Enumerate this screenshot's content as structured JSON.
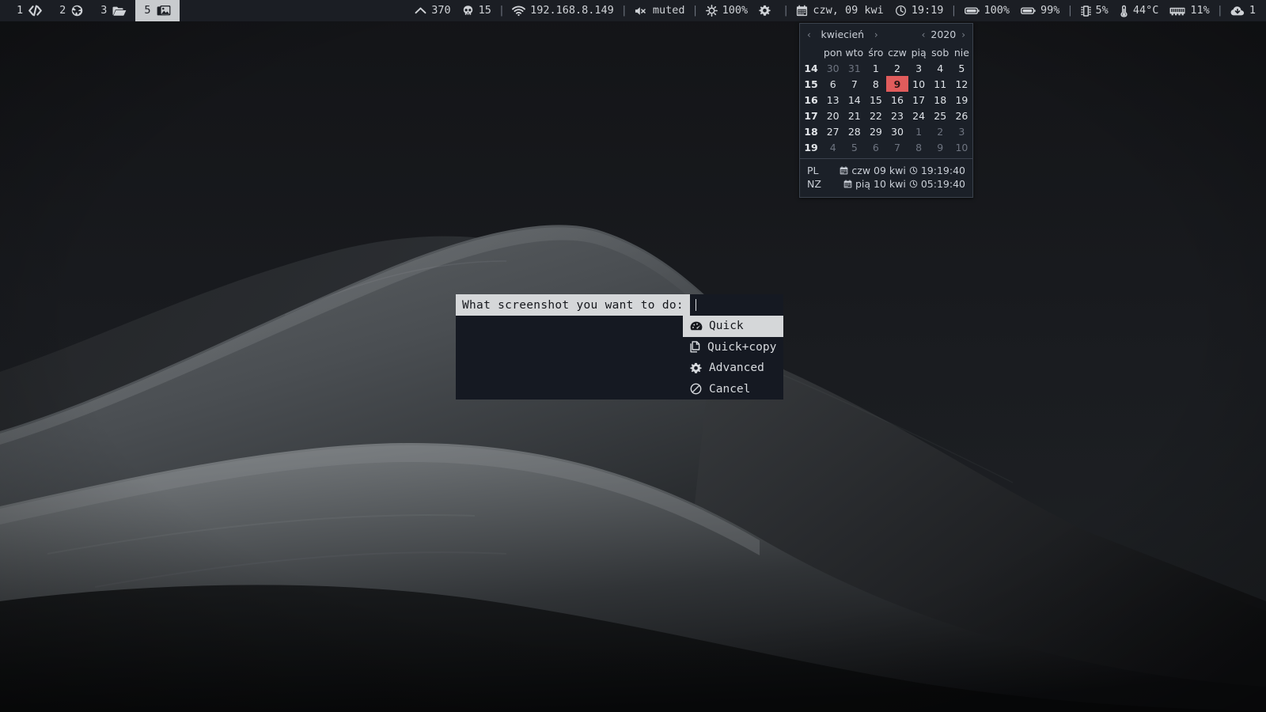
{
  "statusbar": {
    "workspaces": [
      {
        "num": "1",
        "icon": "code-icon",
        "active": false
      },
      {
        "num": "2",
        "icon": "globe-icon",
        "active": false
      },
      {
        "num": "3",
        "icon": "folder-open-icon",
        "active": false
      },
      {
        "num": "5",
        "icon": "image-icon",
        "active": true
      }
    ],
    "segments": [
      {
        "icon": "chevron-up-icon",
        "text": "370"
      },
      {
        "icon": "skull-icon",
        "text": "15"
      },
      {
        "icon": "separator",
        "text": "|"
      },
      {
        "icon": "wifi-icon",
        "text": "192.168.8.149"
      },
      {
        "icon": "separator",
        "text": "|"
      },
      {
        "icon": "volume-muted-icon",
        "text": "muted"
      },
      {
        "icon": "separator",
        "text": "|"
      },
      {
        "icon": "brightness-icon",
        "text": "100%"
      },
      {
        "icon": "gear-icon",
        "text": ""
      },
      {
        "icon": "separator",
        "text": "|"
      },
      {
        "icon": "calendar-icon",
        "text": "czw, 09 kwi"
      },
      {
        "icon": "clock-icon",
        "text": "19:19"
      },
      {
        "icon": "separator",
        "text": "|"
      },
      {
        "icon": "battery-icon",
        "text": "100%"
      },
      {
        "icon": "battery-icon",
        "text": "99%"
      },
      {
        "icon": "separator",
        "text": "|"
      },
      {
        "icon": "cpu-icon",
        "text": "5%"
      },
      {
        "icon": "thermometer-icon",
        "text": "44°C"
      },
      {
        "icon": "memory-icon",
        "text": "11%"
      },
      {
        "icon": "separator",
        "text": "|"
      },
      {
        "icon": "cloud-download-icon",
        "text": "1"
      }
    ]
  },
  "calendar": {
    "month": "kwiecień",
    "year": "2020",
    "prev_month_arrow": "‹",
    "next_month_arrow": "›",
    "prev_year_arrow": "‹",
    "next_year_arrow": "›",
    "weekday_headers": [
      "",
      "pon",
      "wto",
      "śro",
      "czw",
      "pią",
      "sob",
      "nie"
    ],
    "weeks": [
      {
        "wk": "14",
        "days": [
          {
            "d": "30",
            "dim": true
          },
          {
            "d": "31",
            "dim": true
          },
          {
            "d": "1"
          },
          {
            "d": "2"
          },
          {
            "d": "3"
          },
          {
            "d": "4"
          },
          {
            "d": "5"
          }
        ]
      },
      {
        "wk": "15",
        "days": [
          {
            "d": "6"
          },
          {
            "d": "7"
          },
          {
            "d": "8"
          },
          {
            "d": "9",
            "today": true
          },
          {
            "d": "10"
          },
          {
            "d": "11"
          },
          {
            "d": "12"
          }
        ]
      },
      {
        "wk": "16",
        "days": [
          {
            "d": "13"
          },
          {
            "d": "14"
          },
          {
            "d": "15"
          },
          {
            "d": "16"
          },
          {
            "d": "17"
          },
          {
            "d": "18"
          },
          {
            "d": "19"
          }
        ]
      },
      {
        "wk": "17",
        "days": [
          {
            "d": "20"
          },
          {
            "d": "21"
          },
          {
            "d": "22"
          },
          {
            "d": "23"
          },
          {
            "d": "24"
          },
          {
            "d": "25"
          },
          {
            "d": "26"
          }
        ]
      },
      {
        "wk": "18",
        "days": [
          {
            "d": "27"
          },
          {
            "d": "28"
          },
          {
            "d": "29"
          },
          {
            "d": "30"
          },
          {
            "d": "1",
            "dim": true
          },
          {
            "d": "2",
            "dim": true
          },
          {
            "d": "3",
            "dim": true
          }
        ]
      },
      {
        "wk": "19",
        "days": [
          {
            "d": "4",
            "dim": true
          },
          {
            "d": "5",
            "dim": true
          },
          {
            "d": "6",
            "dim": true
          },
          {
            "d": "7",
            "dim": true
          },
          {
            "d": "8",
            "dim": true
          },
          {
            "d": "9",
            "dim": true
          },
          {
            "d": "10",
            "dim": true
          }
        ]
      }
    ],
    "timezones": [
      {
        "name": "PL",
        "date": "czw 09 kwi",
        "time": "19:19:40"
      },
      {
        "name": "NZ",
        "date": "pią 10 kwi",
        "time": "05:19:40"
      }
    ]
  },
  "dmenu": {
    "prompt": "What screenshot you want to do:",
    "input_value": "",
    "items": [
      {
        "label": "Quick",
        "icon": "gauge-icon",
        "selected": true
      },
      {
        "label": "Quick+copy",
        "icon": "copy-icon",
        "selected": false
      },
      {
        "label": "Advanced",
        "icon": "gear-icon",
        "selected": false
      },
      {
        "label": "Cancel",
        "icon": "ban-icon",
        "selected": false
      }
    ]
  },
  "colors": {
    "bar_bg": "#1b1e24",
    "bar_fg": "#cfd2d6",
    "accent_selection": "#d5d7d9",
    "today_highlight": "#e05c5c",
    "menu_bg": "#151922",
    "popup_bg": "#1b2028"
  }
}
